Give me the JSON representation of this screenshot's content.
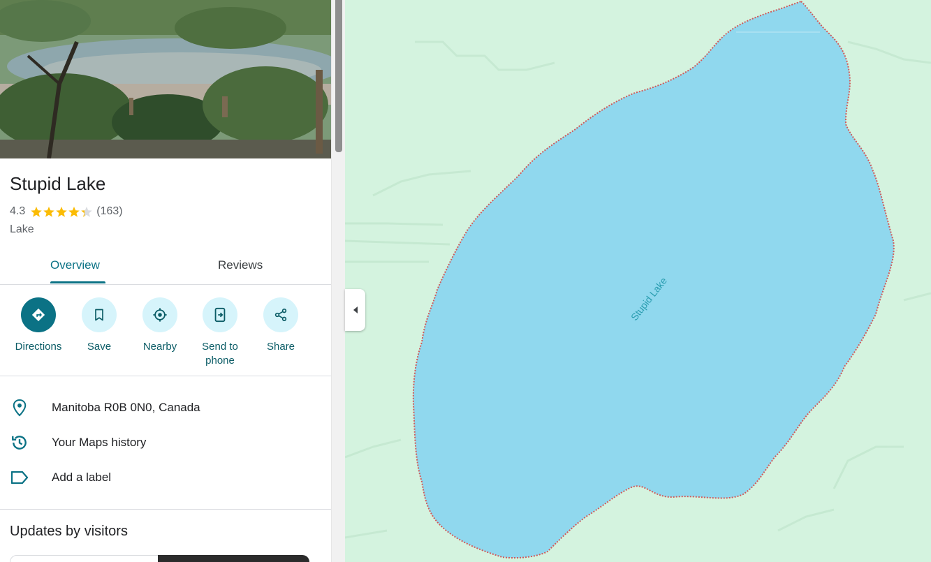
{
  "place": {
    "name": "Stupid Lake",
    "rating": "4.3",
    "rating_value": 4.3,
    "review_count": "(163)",
    "category": "Lake"
  },
  "tabs": [
    {
      "label": "Overview",
      "selected": true
    },
    {
      "label": "Reviews",
      "selected": false
    }
  ],
  "actions": [
    {
      "label": "Directions",
      "icon": "directions-icon"
    },
    {
      "label": "Save",
      "icon": "bookmark-icon"
    },
    {
      "label": "Nearby",
      "icon": "nearby-icon"
    },
    {
      "label": "Send to phone",
      "icon": "send-to-phone-icon"
    },
    {
      "label": "Share",
      "icon": "share-icon"
    }
  ],
  "info": [
    {
      "text": "Manitoba R0B 0N0, Canada",
      "icon": "location-pin-icon"
    },
    {
      "text": "Your Maps history",
      "icon": "history-icon"
    },
    {
      "text": "Add a label",
      "icon": "label-icon"
    }
  ],
  "updates": {
    "title": "Updates by visitors"
  },
  "map": {
    "lake_label": "Stupid Lake"
  },
  "colors": {
    "accent": "#0b7285",
    "water": "#90d8ee",
    "land": "#d4f3df",
    "lake_outline": "#d05a5a",
    "star": "#fbbc04"
  }
}
